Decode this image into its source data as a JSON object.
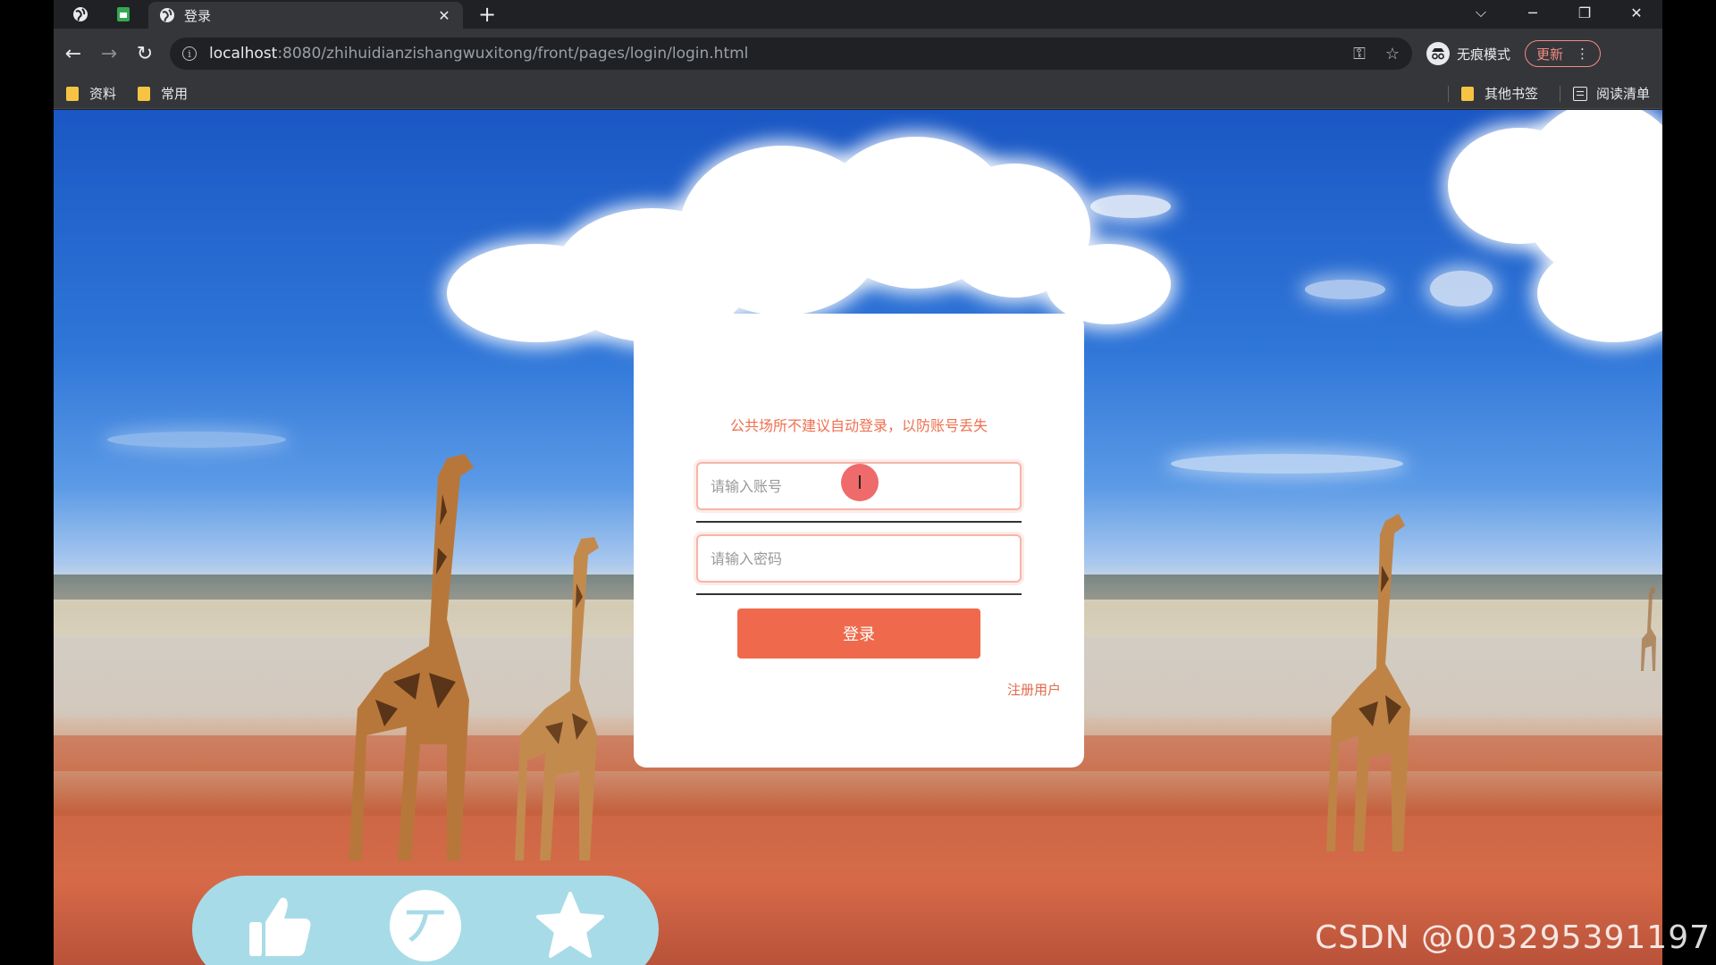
{
  "browser": {
    "tab": {
      "title": "登录",
      "close_symbol": "✕"
    },
    "new_tab_symbol": "+",
    "window_controls": {
      "dropdown": "⌵",
      "minimize": "─",
      "restore": "❐",
      "close": "✕"
    },
    "nav": {
      "back": "←",
      "forward": "→",
      "reload": "↻"
    },
    "url": {
      "info_symbol": "i",
      "host": "localhost",
      "path": ":8080/zhihuidianzishangwuxitong/front/pages/login/login.html"
    },
    "omnibox_icons": {
      "key": "⚿",
      "bookmark_star": "☆"
    },
    "incognito_label": "无痕模式",
    "update_label": "更新",
    "update_menu": "⋮",
    "bookmarks": [
      "资料",
      "常用"
    ],
    "bookmarks_right": {
      "other": "其他书签",
      "reading_list": "阅读清单"
    }
  },
  "login": {
    "tip": "公共场所不建议自动登录，以防账号丢失",
    "account_placeholder": "请输入账号",
    "password_placeholder": "请输入密码",
    "login_button": "登录",
    "register_link": "注册用户",
    "cursor_symbol": "I"
  },
  "action_bar": {
    "coin_glyph": "丆"
  },
  "watermark": "CSDN @003295391197",
  "colors": {
    "accent": "#ef6a4c",
    "input_border": "#f7b5a8",
    "action_bar": "#a8dbe8"
  }
}
